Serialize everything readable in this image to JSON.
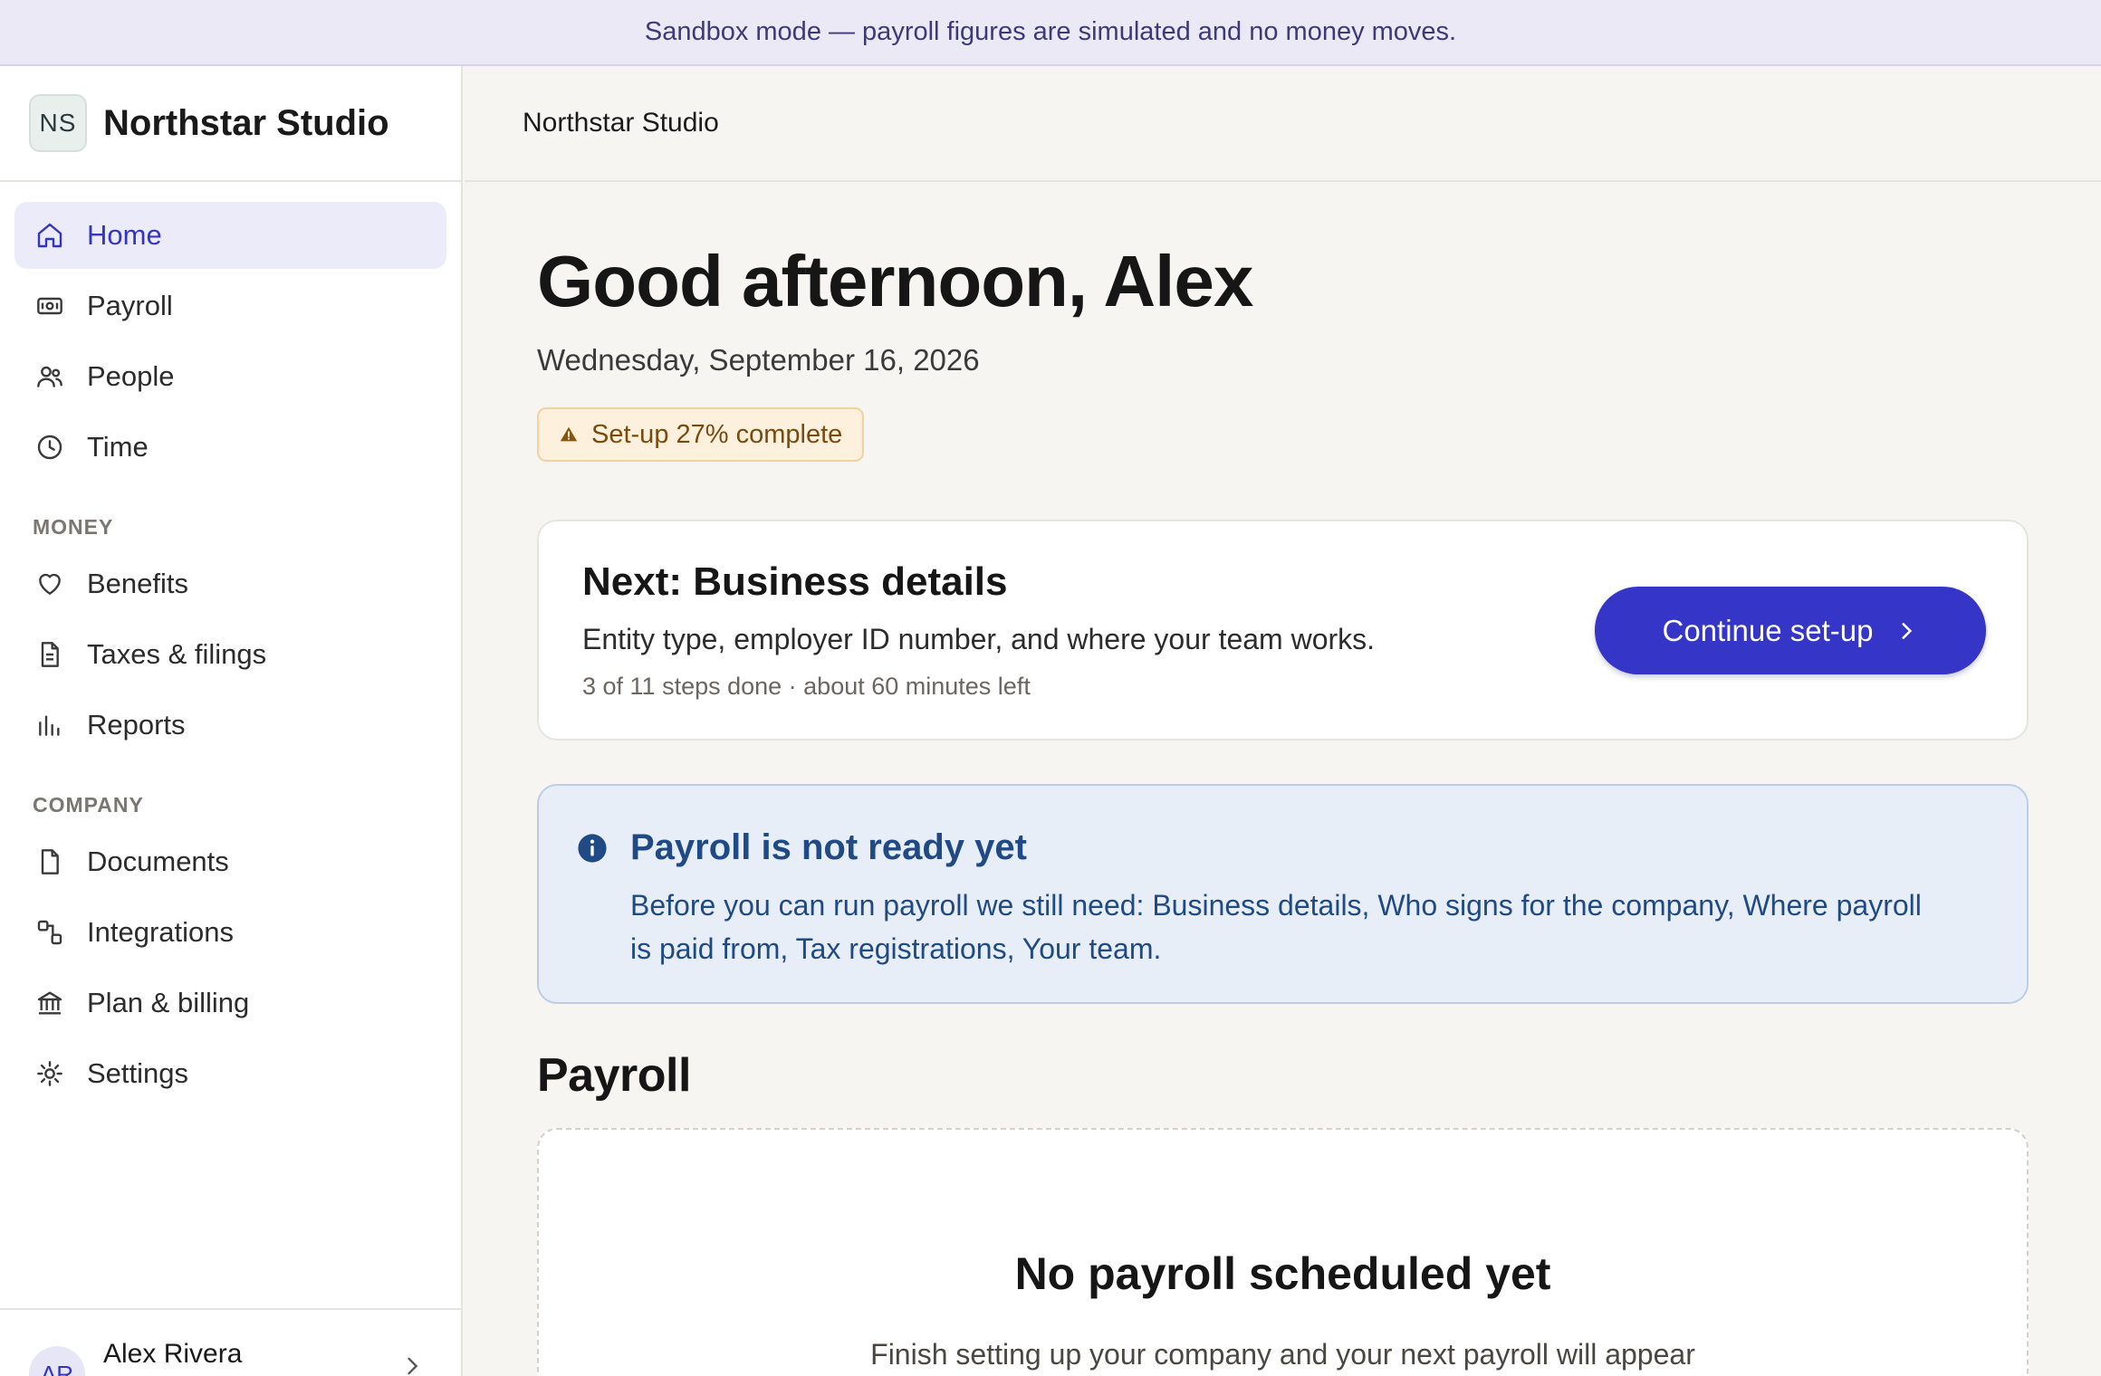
{
  "banner": {
    "text": "Sandbox mode — payroll figures are simulated and no money moves."
  },
  "brand": {
    "initials": "NS",
    "name": "Northstar Studio"
  },
  "nav": {
    "primary": [
      {
        "label": "Home",
        "icon": "home-icon",
        "active": true
      },
      {
        "label": "Payroll",
        "icon": "payroll-icon"
      },
      {
        "label": "People",
        "icon": "people-icon"
      },
      {
        "label": "Time",
        "icon": "clock-icon"
      }
    ],
    "money_label": "MONEY",
    "money": [
      {
        "label": "Benefits",
        "icon": "heart-icon"
      },
      {
        "label": "Taxes & filings",
        "icon": "document-icon"
      },
      {
        "label": "Reports",
        "icon": "bar-chart-icon"
      }
    ],
    "company_label": "COMPANY",
    "company": [
      {
        "label": "Documents",
        "icon": "file-icon"
      },
      {
        "label": "Integrations",
        "icon": "integrations-icon"
      },
      {
        "label": "Plan & billing",
        "icon": "bank-icon"
      },
      {
        "label": "Settings",
        "icon": "gear-icon"
      }
    ]
  },
  "user": {
    "initials": "AR",
    "name": "Alex Rivera"
  },
  "topbar": {
    "company": "Northstar Studio"
  },
  "main": {
    "greeting": "Good afternoon, Alex",
    "date": "Wednesday, September 16, 2026",
    "setup_badge": "Set-up 27% complete",
    "setup_progress_percent": 27
  },
  "next_card": {
    "title": "Next: Business details",
    "description": "Entity type, employer ID number, and where your team works.",
    "meta": "3 of 11 steps done · about 60 minutes left",
    "button": "Continue set-up"
  },
  "alert": {
    "title": "Payroll is not ready yet",
    "body": "Before you can run payroll we still need: Business details, Who signs for the company, Where payroll is paid from, Tax registrations, Your team."
  },
  "payroll_section": {
    "title": "Payroll",
    "empty_title": "No payroll scheduled yet",
    "empty_body": "Finish setting up your company and your next payroll will appear"
  },
  "colors": {
    "accent": "#3535c8",
    "active_nav_bg": "#ecebfa",
    "warning_bg": "#fdf1dd",
    "info_bg": "#e8eef8",
    "info_text": "#204a86"
  }
}
